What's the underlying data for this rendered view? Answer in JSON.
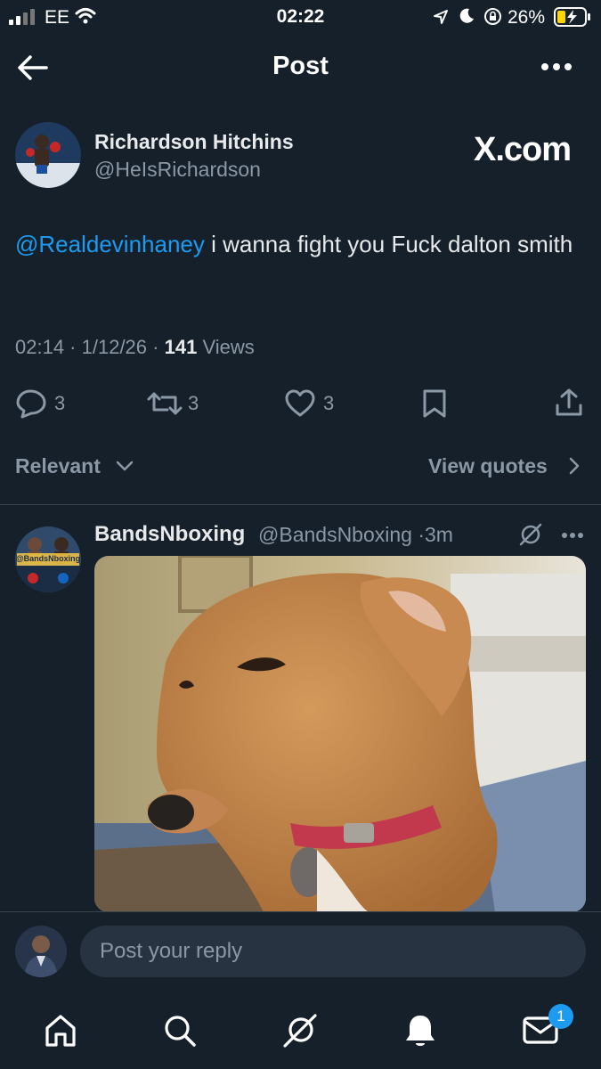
{
  "status_bar": {
    "carrier": "EE",
    "time": "02:22",
    "battery_percent": "26%"
  },
  "header": {
    "title": "Post"
  },
  "tweet": {
    "author_name": "Richardson Hitchins",
    "author_handle": "@HeIsRichardson",
    "brand": "X.com",
    "mention": "@Realdevinhaney",
    "text": " i wanna fight you Fuck dalton smith",
    "time": "02:14",
    "date": "1/12/26",
    "views_count": "141",
    "views_label": "Views",
    "reply_count": "3",
    "repost_count": "3",
    "like_count": "3"
  },
  "replies_sort": {
    "sort_label": "Relevant",
    "view_quotes_label": "View quotes"
  },
  "reply": {
    "author_name": "BandsNboxing",
    "author_handle": "@BandsNboxing",
    "age": "3m",
    "avatar_text": "@BandsNboxing"
  },
  "composer": {
    "placeholder": "Post your reply"
  },
  "tab_bar": {
    "messages_badge": "1"
  },
  "colors": {
    "background": "#15202b",
    "accent": "#1d9bf0",
    "secondary_text": "#8b98a5"
  }
}
